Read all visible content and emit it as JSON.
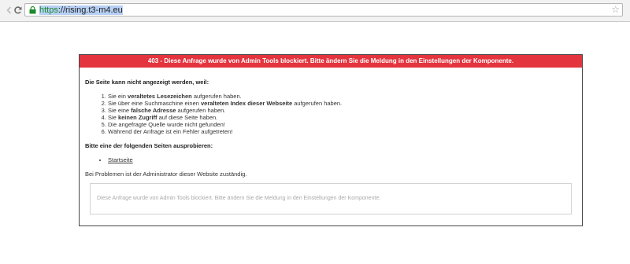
{
  "browser": {
    "url_scheme": "https",
    "url_rest": "://rising.t3-m4.eu",
    "back_icon": "arrow-left-icon",
    "reload_icon": "reload-icon",
    "lock_icon": "lock-icon",
    "star_icon": "star-icon",
    "secure_color": "#1c8a2a"
  },
  "error": {
    "header": "403 - Diese Anfrage wurde von Admin Tools blockiert. Bitte ändern Sie die Meldung in den Einstellungen der Komponente.",
    "header_color": "#e4343e",
    "intro": "Die Seite kann nicht angezeigt werden, weil:",
    "reasons": [
      {
        "pre": "Sie ein ",
        "bold": "veraltetes Lesezeichen",
        "post": " aufgerufen haben."
      },
      {
        "pre": "Sie über eine Suchmaschine einen ",
        "bold": "veralteten Index dieser Webseite",
        "post": " aufgerufen haben."
      },
      {
        "pre": "Sie eine ",
        "bold": "falsche Adresse",
        "post": " aufgerufen haben."
      },
      {
        "pre": "Sie ",
        "bold": "keinen Zugriff",
        "post": " auf diese Seite haben."
      },
      {
        "pre": "Die angefragte Quelle wurde nicht gefunden!",
        "bold": "",
        "post": ""
      },
      {
        "pre": "Während der Anfrage ist ein Fehler aufgetreten!",
        "bold": "",
        "post": ""
      }
    ],
    "try_heading": "Bitte eine der folgenden Seiten ausprobieren:",
    "home_link": "Startseite",
    "problem_text": "Bei Problemen ist der Administrator dieser Website zuständig.",
    "message": "Diese Anfrage wurde von Admin Tools blockiert. Bitte ändern Sie die Meldung in den Einstellungen der Komponente."
  }
}
